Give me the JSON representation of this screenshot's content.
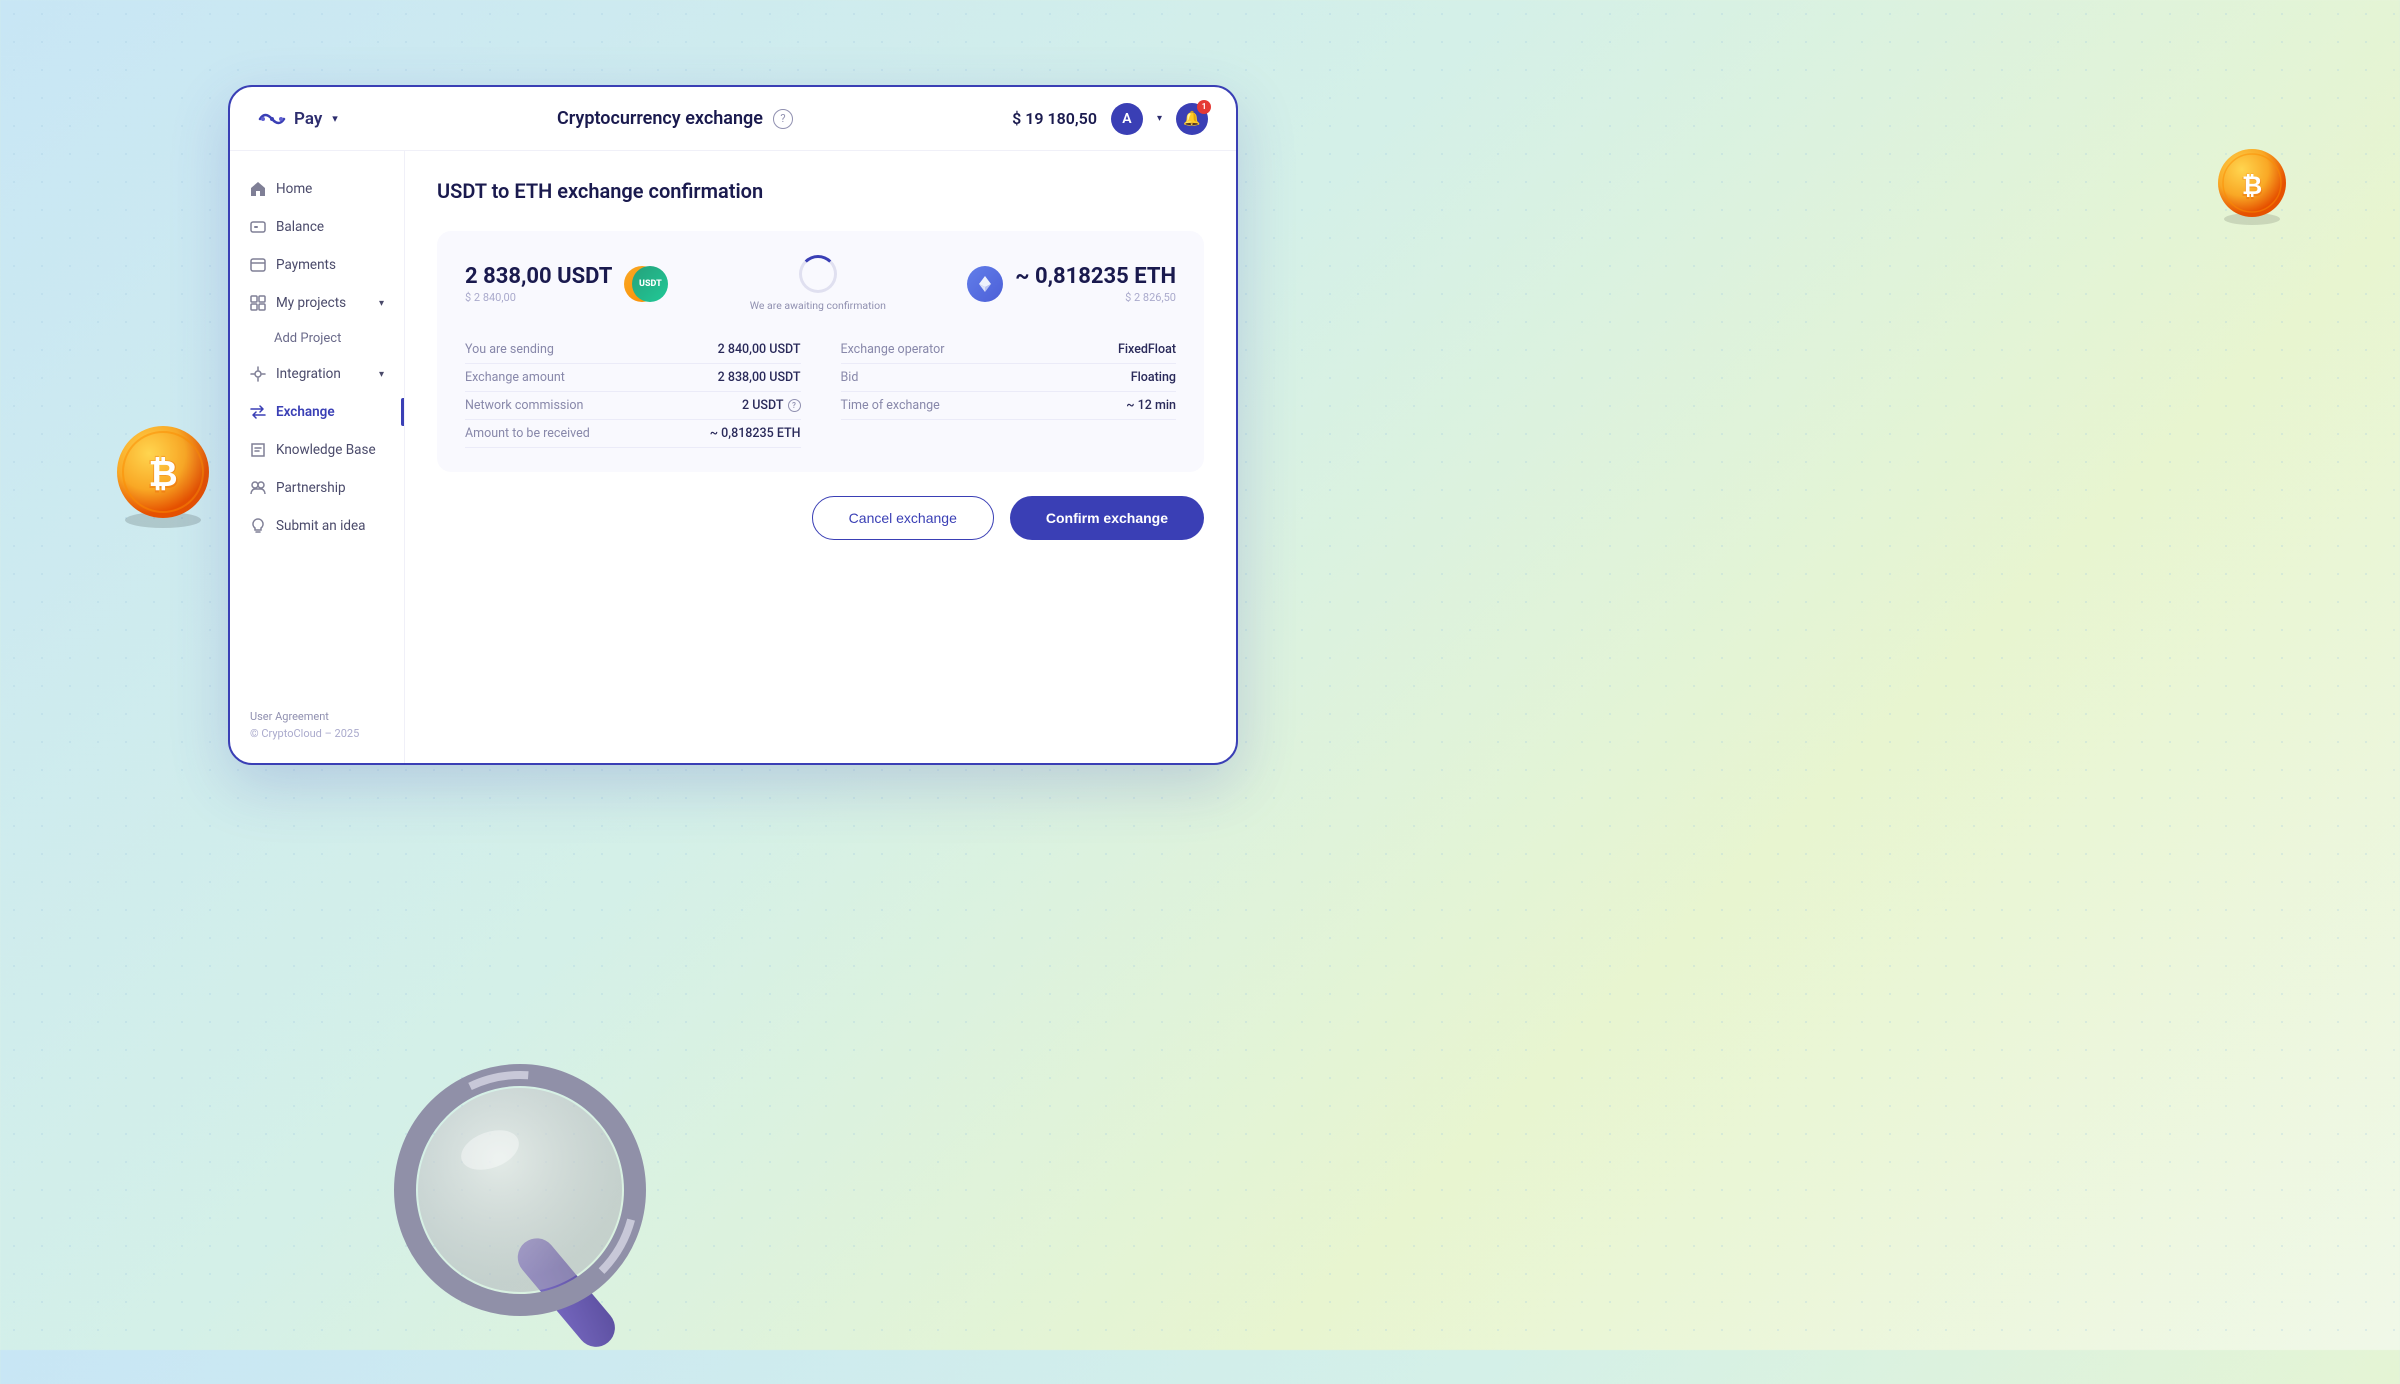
{
  "header": {
    "logo_text": "Pay",
    "title": "Cryptocurrency exchange",
    "help_label": "?",
    "balance": "$ 19 180,50",
    "avatar_label": "A",
    "notification_count": "1"
  },
  "sidebar": {
    "items": [
      {
        "id": "home",
        "label": "Home",
        "icon": "home-icon",
        "active": false
      },
      {
        "id": "balance",
        "label": "Balance",
        "icon": "balance-icon",
        "active": false
      },
      {
        "id": "payments",
        "label": "Payments",
        "icon": "payments-icon",
        "active": false
      },
      {
        "id": "my-projects",
        "label": "My projects",
        "icon": "projects-icon",
        "active": false,
        "expandable": true
      },
      {
        "id": "add-project",
        "label": "Add Project",
        "icon": "",
        "active": false,
        "sub": true
      },
      {
        "id": "integration",
        "label": "Integration",
        "icon": "integration-icon",
        "active": false,
        "expandable": true
      },
      {
        "id": "exchange",
        "label": "Exchange",
        "icon": "exchange-icon",
        "active": true
      },
      {
        "id": "knowledge-base",
        "label": "Knowledge Base",
        "icon": "knowledge-icon",
        "active": false
      },
      {
        "id": "partnership",
        "label": "Partnership",
        "icon": "partnership-icon",
        "active": false
      },
      {
        "id": "submit-idea",
        "label": "Submit an idea",
        "icon": "idea-icon",
        "active": false
      }
    ],
    "footer": {
      "user_agreement": "User Agreement",
      "copyright": "© CryptoCloud – 2025"
    }
  },
  "main": {
    "page_title": "USDT to ETH exchange confirmation",
    "exchange": {
      "from_amount": "2 838,00 USDT",
      "from_usd": "$ 2 840,00",
      "to_amount": "~ 0,818235 ETH",
      "to_usd": "$ 2 826,50",
      "status_text": "We are awaiting confirmation",
      "details": {
        "you_are_sending_label": "You are sending",
        "you_are_sending_value": "2 840,00 USDT",
        "exchange_amount_label": "Exchange amount",
        "exchange_amount_value": "2 838,00 USDT",
        "network_commission_label": "Network commission",
        "network_commission_value": "2 USDT",
        "amount_to_receive_label": "Amount to be received",
        "amount_to_receive_value": "~ 0,818235 ETH",
        "exchange_operator_label": "Exchange operator",
        "exchange_operator_value": "FixedFloat",
        "bid_label": "Bid",
        "bid_value": "Floating",
        "time_of_exchange_label": "Time of exchange",
        "time_of_exchange_value": "~ 12 min"
      }
    },
    "buttons": {
      "cancel_label": "Cancel exchange",
      "confirm_label": "Confirm exchange"
    }
  }
}
